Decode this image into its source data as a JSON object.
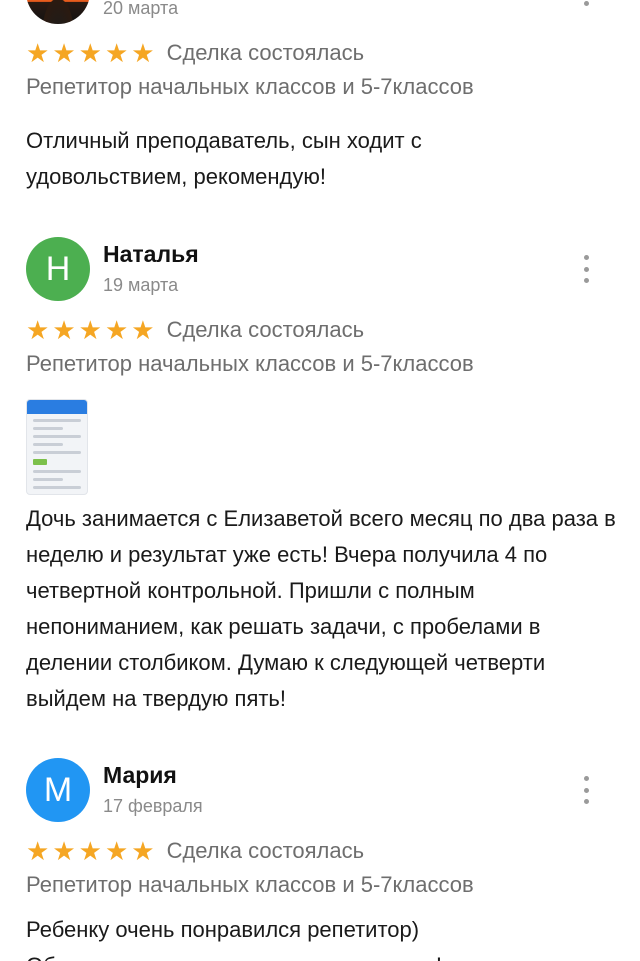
{
  "reviews": [
    {
      "name": "",
      "date": "20 марта",
      "avatar_letter": "",
      "avatar_color": "#e8581c",
      "rating": 5,
      "deal_label": "Сделка состоялась",
      "subject": "Репетитор начальных классов и 5-7классов",
      "text": "Отличный преподаватель, сын ходит с удовольствием, рекомендую!"
    },
    {
      "name": "Наталья",
      "date": "19 марта",
      "avatar_letter": "Н",
      "avatar_color": "#4caf50",
      "rating": 5,
      "deal_label": "Сделка состоялась",
      "subject": "Репетитор начальных классов и 5-7классов",
      "text": "Дочь занимается с Елизаветой всего месяц по два раза в неделю и результат уже есть! Вчера получила 4 по четвертной контрольной. Пришли с полным непониманием, как решать задачи, с пробелами в делении столбиком. Думаю к следующей четверти выйдем на твердую пять!"
    },
    {
      "name": "Мария",
      "date": "17 февраля",
      "avatar_letter": "М",
      "avatar_color": "#2196f3",
      "rating": 5,
      "deal_label": "Сделка состоялась",
      "subject": "Репетитор начальных классов и 5-7классов",
      "text": "Ребенку очень понравился репетитор) Общение и запись на урок понравилась!"
    }
  ],
  "colors": {
    "star": "#f5a623",
    "muted_text": "#6e6e6e"
  },
  "icons": [
    "more-vertical-icon",
    "star-icon"
  ]
}
